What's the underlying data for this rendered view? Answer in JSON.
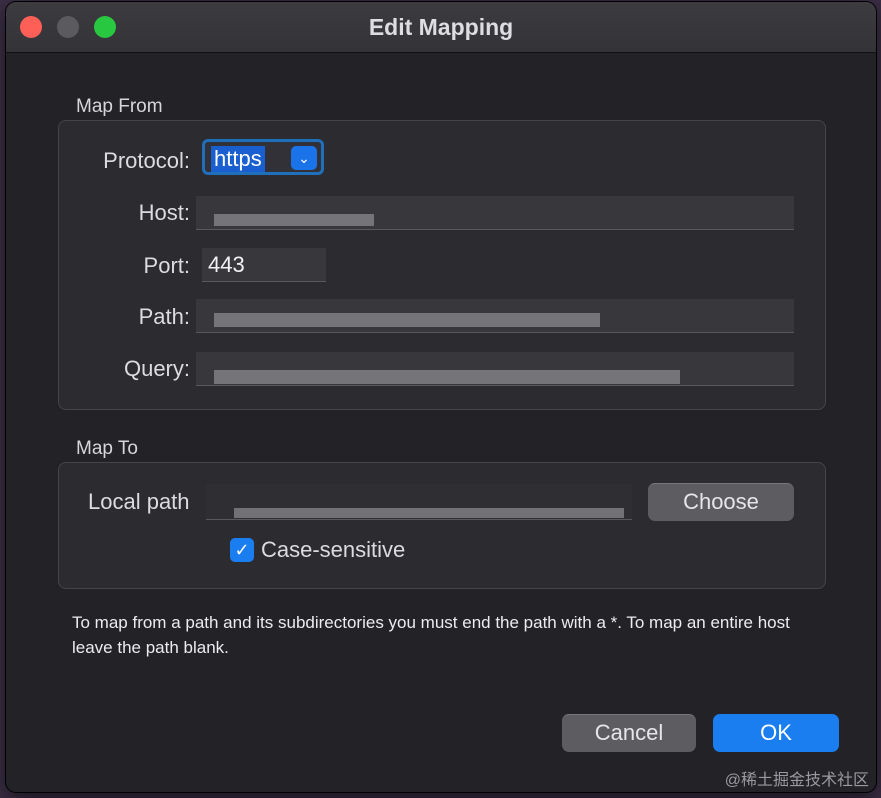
{
  "window": {
    "title": "Edit Mapping"
  },
  "map_from": {
    "label": "Map From",
    "protocol": {
      "label": "Protocol:",
      "value": "https"
    },
    "host": {
      "label": "Host:"
    },
    "port": {
      "label": "Port:",
      "value": "443"
    },
    "path": {
      "label": "Path:"
    },
    "query": {
      "label": "Query:"
    }
  },
  "map_to": {
    "label": "Map To",
    "local_path": {
      "label": "Local path"
    },
    "choose_label": "Choose",
    "case_sensitive": {
      "label": "Case-sensitive",
      "checked": true
    }
  },
  "help_text": "To map from a path and its subdirectories you must end the path with a *. To map an entire host leave the path blank.",
  "buttons": {
    "cancel": "Cancel",
    "ok": "OK"
  },
  "watermark": "@稀土掘金技术社区",
  "colors": {
    "accent": "#1a7ef0",
    "window_bg": "#232226",
    "close": "#fe5f57",
    "maximize": "#28c840"
  }
}
